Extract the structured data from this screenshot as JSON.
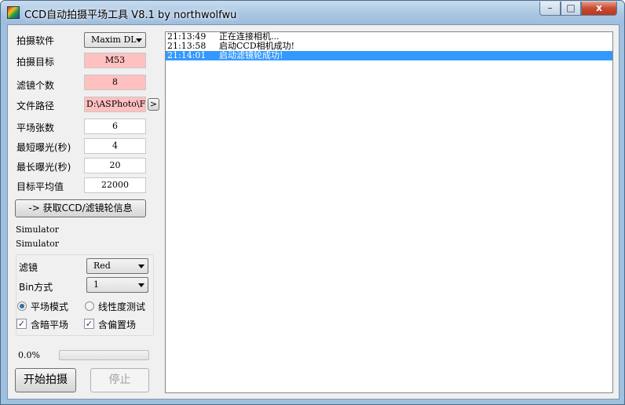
{
  "window": {
    "title": "CCD自动拍摄平场工具 V8.1 by northwolfwu",
    "minimize_glyph": "–",
    "maximize_glyph": "□",
    "close_glyph": "x"
  },
  "form": {
    "software_label": "拍摄软件",
    "software_value": "Maxim DL",
    "target_label": "拍摄目标",
    "target_value": "M53",
    "filter_count_label": "滤镜个数",
    "filter_count_value": "8",
    "path_label": "文件路径",
    "path_value": "D:\\ASPhoto\\F",
    "browse_label": ">",
    "flats_label": "平场张数",
    "flats_value": "6",
    "min_exp_label": "最短曝光(秒)",
    "min_exp_value": "4",
    "max_exp_label": "最长曝光(秒)",
    "max_exp_value": "20",
    "target_avg_label": "目标平均值",
    "target_avg_value": "22000",
    "get_info_button": "-> 获取CCD/滤镜轮信息"
  },
  "devices": [
    "Simulator",
    "Simulator"
  ],
  "options": {
    "filter_label": "滤镜",
    "filter_value": "Red",
    "bin_label": "Bin方式",
    "bin_value": "1",
    "mode_flat_label": "平场模式",
    "mode_linear_label": "线性度测试",
    "selected_mode": "flat",
    "include_dark_label": "含暗平场",
    "include_dark_checked": true,
    "include_bias_label": "含偏置场",
    "include_bias_checked": true
  },
  "progress": {
    "text": "0.0%",
    "fraction": 0.0
  },
  "actions": {
    "start_label": "开始拍摄",
    "stop_label": "停止"
  },
  "log": [
    {
      "time": "21:13:49",
      "message": "正在连接相机...",
      "selected": false
    },
    {
      "time": "21:13:58",
      "message": "启动CCD相机成功!",
      "selected": false
    },
    {
      "time": "21:14:01",
      "message": "启动滤镜轮成功!",
      "selected": true
    }
  ],
  "colors": {
    "required_field_bg": "#ffc0c0",
    "selection_bg": "#3399ff",
    "titlebar": "#a9c6e3"
  },
  "icons": {
    "app": "app-icon",
    "radio_on": "radio-selected-icon",
    "check": "checkmark-icon"
  }
}
